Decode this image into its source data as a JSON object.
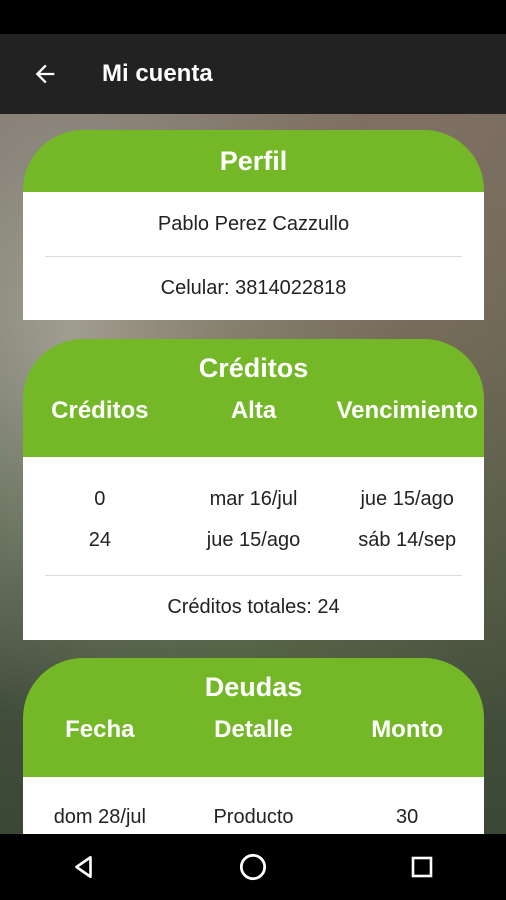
{
  "app_bar": {
    "title": "Mi cuenta",
    "back_icon": "arrow-left-icon"
  },
  "perfil": {
    "title": "Perfil",
    "name": "Pablo Perez Cazzullo",
    "phone": "Celular: 3814022818"
  },
  "creditos": {
    "title": "Créditos",
    "columns": [
      "Créditos",
      "Alta",
      "Vencimiento"
    ],
    "rows": [
      [
        "0",
        "mar 16/jul",
        "jue 15/ago"
      ],
      [
        "24",
        "jue 15/ago",
        "sáb 14/sep"
      ]
    ],
    "total": "Créditos totales: 24"
  },
  "deudas": {
    "title": "Deudas",
    "columns": [
      "Fecha",
      "Detalle",
      "Monto"
    ],
    "rows": [
      [
        "dom 28/jul",
        "Producto",
        "30"
      ]
    ]
  },
  "nav": {
    "back_icon": "triangle-back-icon",
    "home_icon": "circle-home-icon",
    "recents_icon": "square-recents-icon"
  },
  "colors": {
    "accent": "#74b828",
    "app_bar": "#222222"
  }
}
